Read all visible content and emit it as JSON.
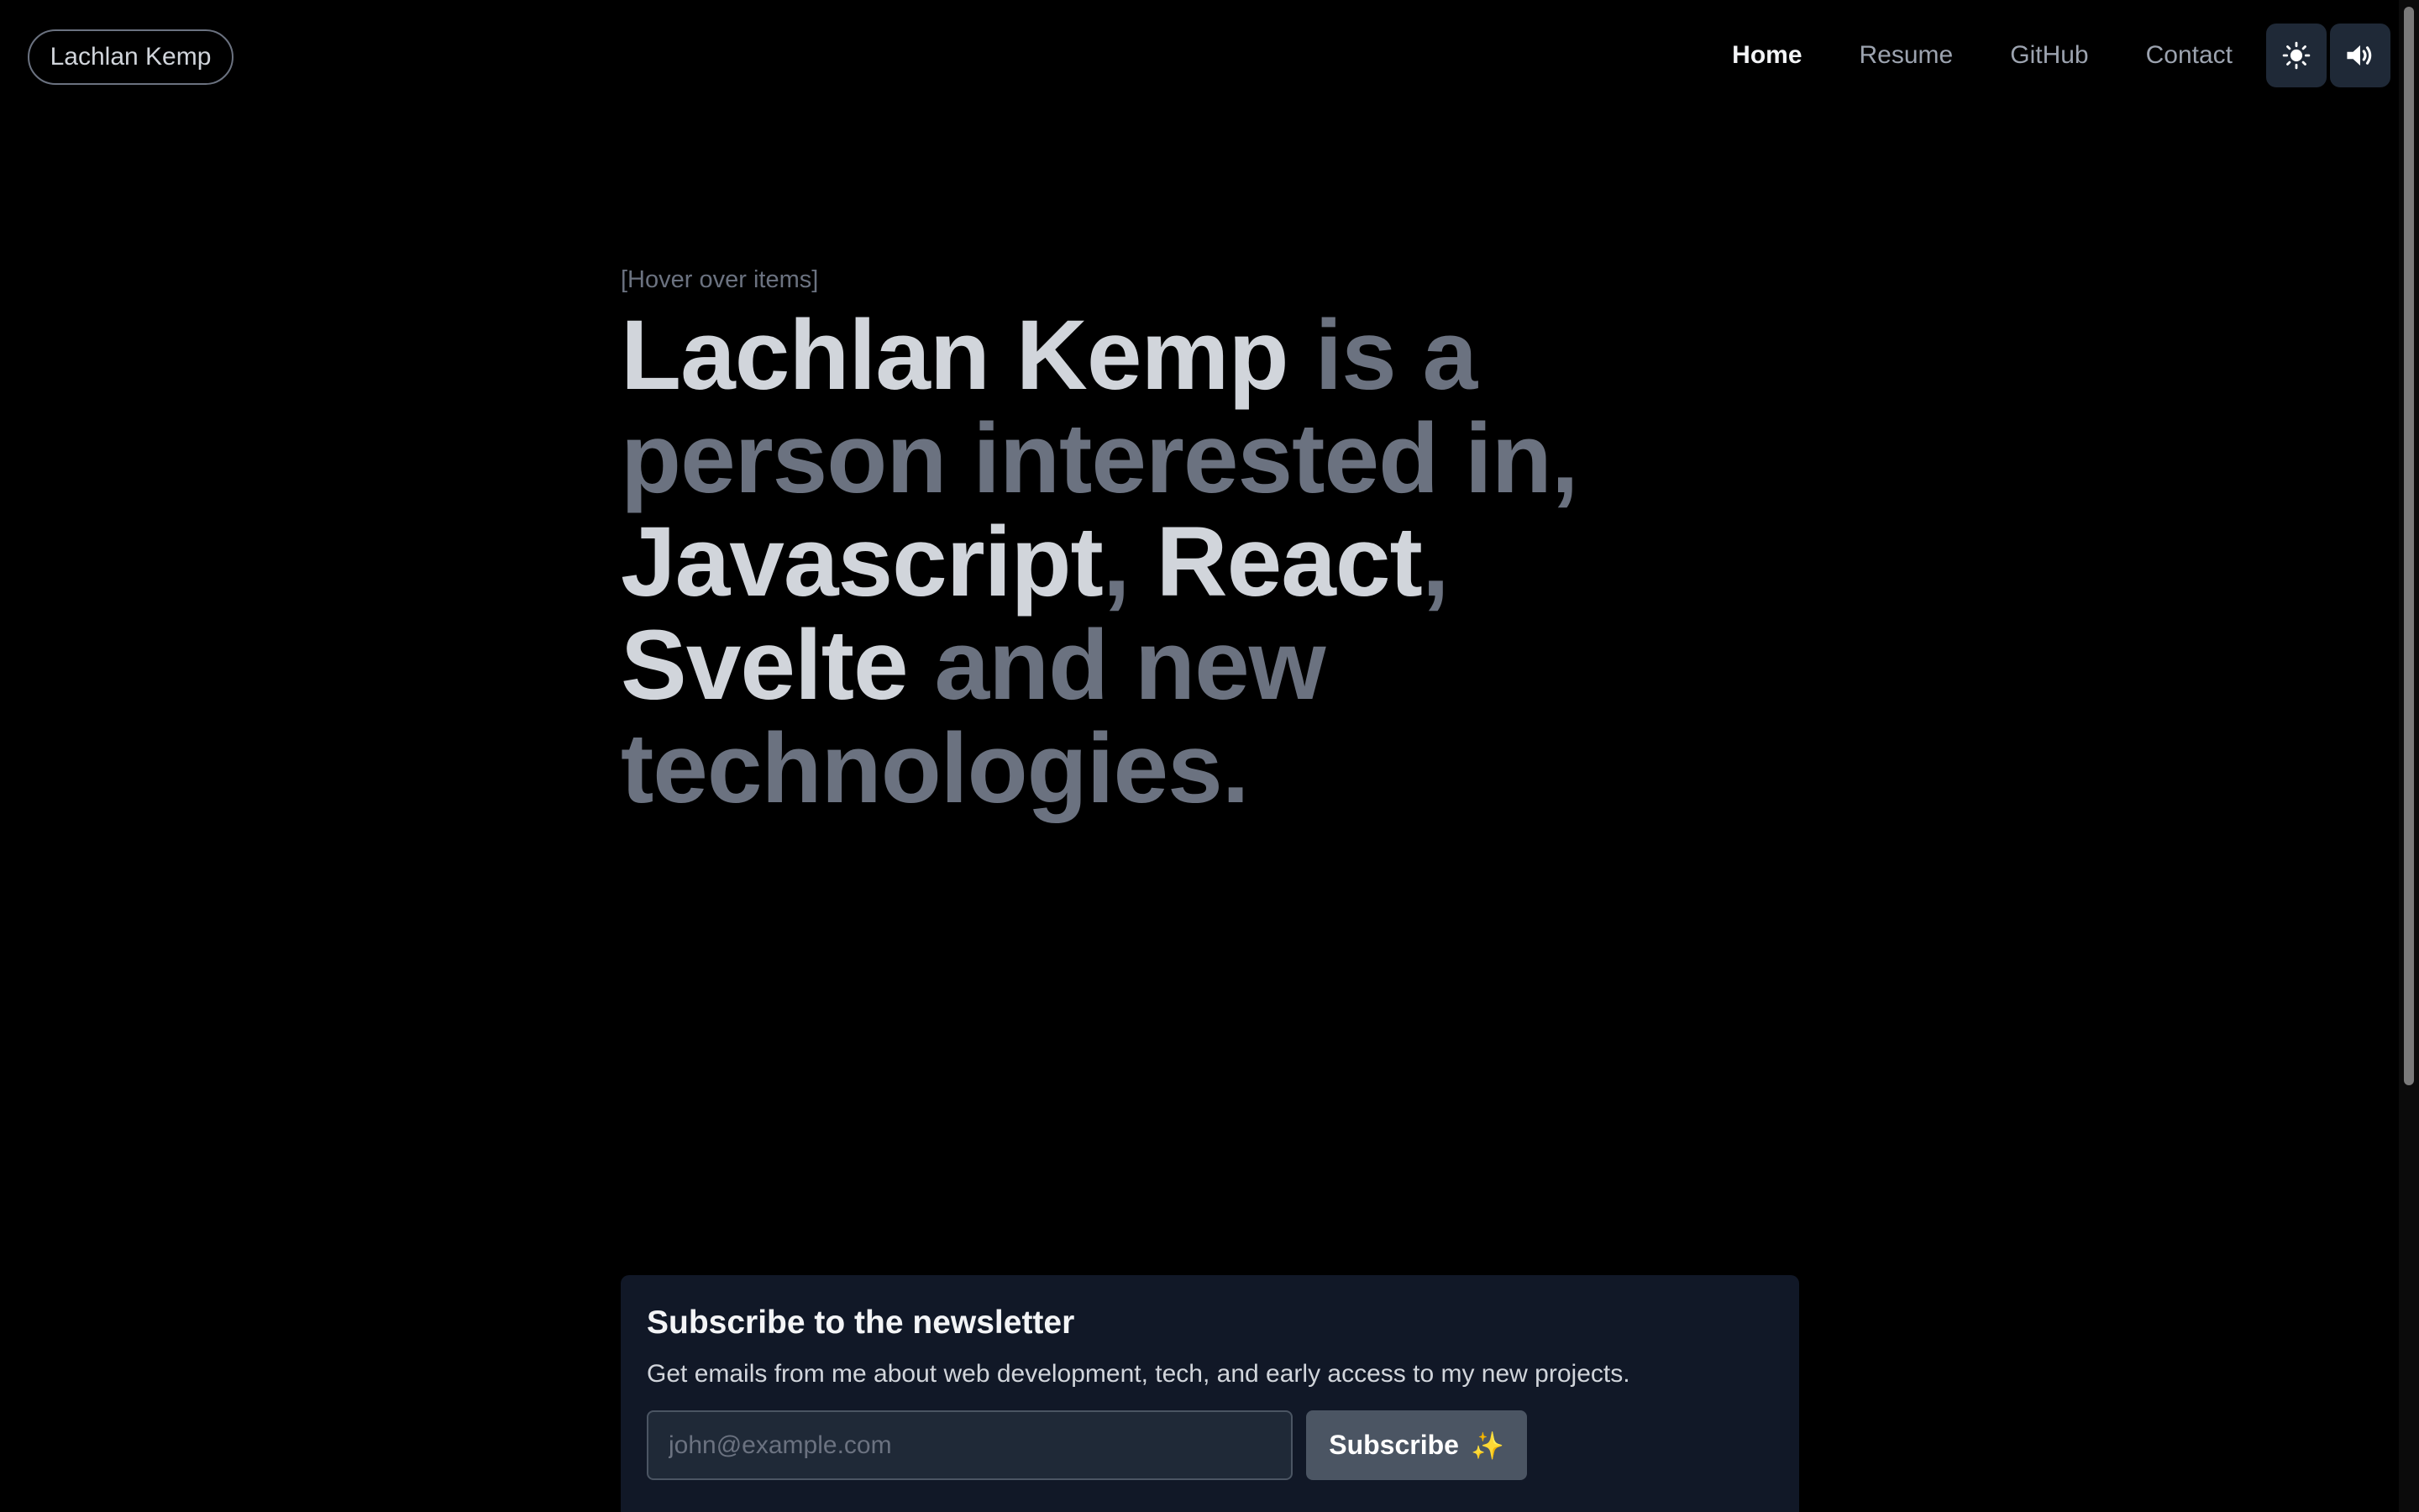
{
  "header": {
    "logo_text": "Lachlan Kemp",
    "nav": [
      {
        "label": "Home",
        "active": true
      },
      {
        "label": "Resume",
        "active": false
      },
      {
        "label": "GitHub",
        "active": false
      },
      {
        "label": "Contact",
        "active": false
      }
    ],
    "theme_toggle_icon": "sun-icon",
    "sound_toggle_icon": "speaker-icon"
  },
  "hero": {
    "hint": "[Hover over items]",
    "name": "Lachlan Kemp",
    "text_1": " is a person interested in, ",
    "item_1": "Javascript",
    "comma_1": ", ",
    "item_2": "React",
    "comma_2": ", ",
    "item_3": "Svelte",
    "text_2": " and new technologies."
  },
  "newsletter": {
    "title": "Subscribe to the newsletter",
    "description": "Get emails from me about web development, tech, and early access to my new projects.",
    "email_placeholder": "john@example.com",
    "button_label": "Subscribe",
    "button_emoji": "✨"
  },
  "colors": {
    "background": "#000000",
    "highlight_text": "#d1d5db",
    "muted_text": "#6b7280",
    "card_bg": "#111827",
    "button_bg": "#4b5563"
  }
}
